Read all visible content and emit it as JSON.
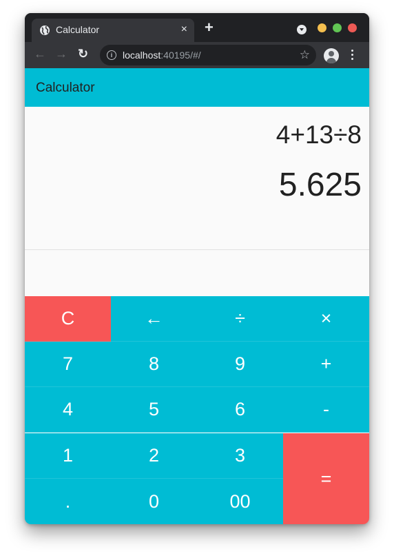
{
  "browser": {
    "tab_title": "Calculator",
    "tab_close": "×",
    "new_tab": "+",
    "nav_back": "←",
    "nav_forward": "→",
    "nav_reload": "↻",
    "info": "i",
    "url_host": "localhost",
    "url_rest": ":40195/#/",
    "star": "☆"
  },
  "app": {
    "title": "Calculator",
    "expression": "4+13÷8",
    "result": "5.625",
    "colors": {
      "primary": "#00bcd4",
      "accent": "#f75656"
    }
  },
  "keypad": {
    "keys": [
      {
        "label": "C",
        "name": "clear-button",
        "color": "red"
      },
      {
        "label": "←",
        "name": "backspace-button",
        "color": "primary"
      },
      {
        "label": "÷",
        "name": "divide-button",
        "color": "primary"
      },
      {
        "label": "×",
        "name": "multiply-button",
        "color": "primary"
      },
      {
        "label": "7",
        "name": "digit-7-button",
        "color": "primary"
      },
      {
        "label": "8",
        "name": "digit-8-button",
        "color": "primary"
      },
      {
        "label": "9",
        "name": "digit-9-button",
        "color": "primary"
      },
      {
        "label": "+",
        "name": "add-button",
        "color": "primary"
      },
      {
        "label": "4",
        "name": "digit-4-button",
        "color": "primary"
      },
      {
        "label": "5",
        "name": "digit-5-button",
        "color": "primary"
      },
      {
        "label": "6",
        "name": "digit-6-button",
        "color": "primary"
      },
      {
        "label": "-",
        "name": "subtract-button",
        "color": "primary"
      },
      {
        "label": "1",
        "name": "digit-1-button",
        "color": "primary"
      },
      {
        "label": "2",
        "name": "digit-2-button",
        "color": "primary"
      },
      {
        "label": "3",
        "name": "digit-3-button",
        "color": "primary"
      },
      {
        "label": "=",
        "name": "equals-button",
        "color": "red"
      },
      {
        "label": ".",
        "name": "decimal-button",
        "color": "primary"
      },
      {
        "label": "0",
        "name": "digit-0-button",
        "color": "primary"
      },
      {
        "label": "00",
        "name": "double-zero-button",
        "color": "primary"
      }
    ]
  }
}
